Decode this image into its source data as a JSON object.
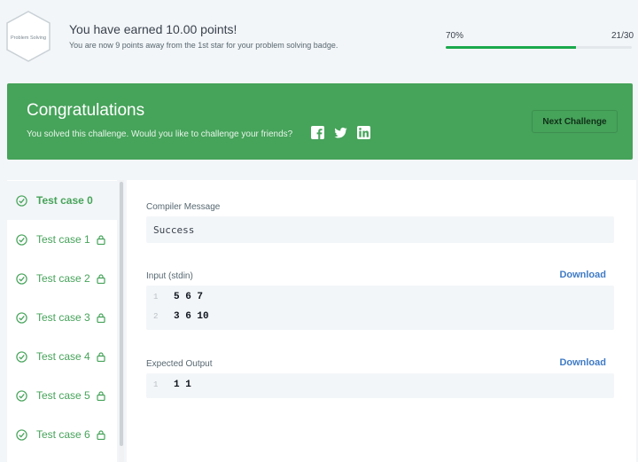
{
  "banner": {
    "badge_text": "Problem Solving",
    "title": "You have earned 10.00 points!",
    "subtitle": "You are now 9 points away from the 1st star for your problem solving badge.",
    "percent": "70%",
    "progress_fraction": 0.7,
    "fraction": "21/30"
  },
  "congrats": {
    "title": "Congratulations",
    "subtitle": "You solved this challenge. Would you like to challenge your friends?",
    "social_icons": [
      "facebook-icon",
      "twitter-icon",
      "linkedin-icon"
    ],
    "next_label": "Next Challenge",
    "color": "#46a35a"
  },
  "sidebar": {
    "items": [
      {
        "label": "Test case 0",
        "active": true,
        "locked": false
      },
      {
        "label": "Test case 1",
        "active": false,
        "locked": true
      },
      {
        "label": "Test case 2",
        "active": false,
        "locked": true
      },
      {
        "label": "Test case 3",
        "active": false,
        "locked": true
      },
      {
        "label": "Test case 4",
        "active": false,
        "locked": true
      },
      {
        "label": "Test case 5",
        "active": false,
        "locked": true
      },
      {
        "label": "Test case 6",
        "active": false,
        "locked": true
      }
    ]
  },
  "main": {
    "compiler_label": "Compiler Message",
    "compiler_value": "Success",
    "input_label": "Input (stdin)",
    "input_download": "Download",
    "input_lines": [
      {
        "num": "1",
        "text": "5 6 7"
      },
      {
        "num": "2",
        "text": "3 6 10"
      }
    ],
    "expected_label": "Expected Output",
    "expected_download": "Download",
    "expected_lines": [
      {
        "num": "1",
        "text": "1 1"
      }
    ]
  }
}
